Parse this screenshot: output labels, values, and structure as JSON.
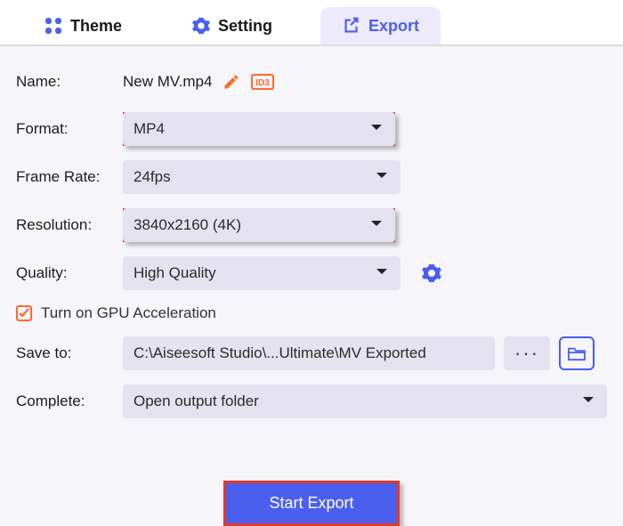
{
  "tabs": {
    "theme": "Theme",
    "setting": "Setting",
    "export": "Export"
  },
  "labels": {
    "name": "Name:",
    "format": "Format:",
    "frameRate": "Frame Rate:",
    "resolution": "Resolution:",
    "quality": "Quality:",
    "saveTo": "Save to:",
    "complete": "Complete:"
  },
  "name": {
    "value": "New MV.mp4"
  },
  "format": {
    "selected": "MP4"
  },
  "frameRate": {
    "selected": "24fps"
  },
  "resolution": {
    "selected": "3840x2160 (4K)"
  },
  "quality": {
    "selected": "High Quality"
  },
  "gpu": {
    "label": "Turn on GPU Acceleration",
    "checked": true
  },
  "saveTo": {
    "path": "C:\\Aiseesoft Studio\\...Ultimate\\MV Exported"
  },
  "complete": {
    "selected": "Open output folder"
  },
  "actions": {
    "startExport": "Start Export"
  },
  "colors": {
    "accent": "#4b5fef",
    "highlight": "#e13a28",
    "orange": "#ff6a2b"
  }
}
